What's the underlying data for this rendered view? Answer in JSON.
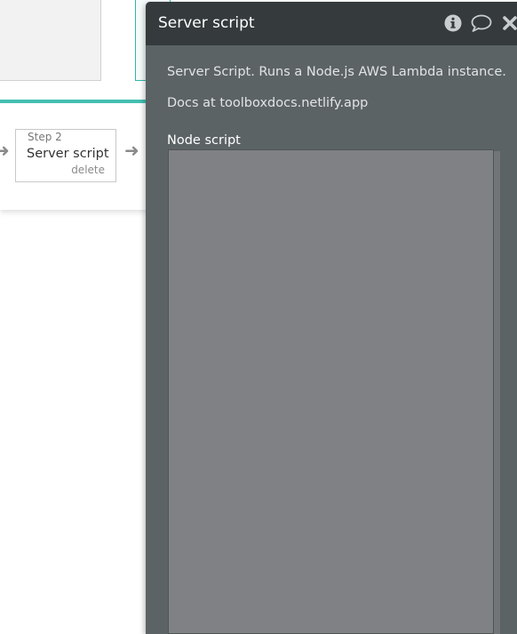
{
  "workflow": {
    "step": {
      "number_label": "Step 2",
      "title": "Server script",
      "delete_label": "delete"
    }
  },
  "panel": {
    "title": "Server script",
    "icons": [
      "info-icon",
      "comment-icon",
      "close-icon"
    ],
    "description": "Server Script. Runs a Node.js AWS Lambda instance.",
    "docs_text": "Docs at toolboxdocs.netlify.app",
    "field_label": "Node script",
    "field_value": ""
  },
  "colors": {
    "accent": "#43bfb1",
    "panel_header": "#353b3c",
    "panel_body": "#5c6365",
    "code_bg": "#808184"
  }
}
